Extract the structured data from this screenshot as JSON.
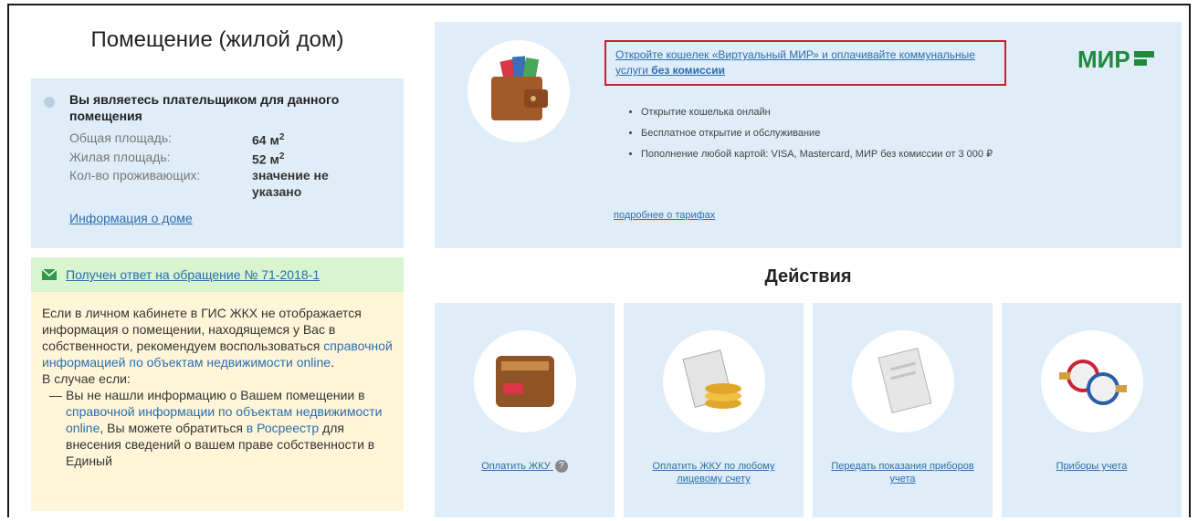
{
  "left": {
    "title": "Помещение (жилой дом)",
    "payer_text": "Вы являетесь плательщиком для данного помещения",
    "fields": [
      {
        "label": "Общая площадь:",
        "value": "64 м",
        "sup": "2"
      },
      {
        "label": "Жилая площадь:",
        "value": "52 м",
        "sup": "2"
      },
      {
        "label": "Кол-во проживающих:",
        "value": "значение не указано",
        "sup": ""
      }
    ],
    "house_link": "Информация о доме",
    "notice_link": "Получен ответ на обращение № 71-2018-1",
    "help": {
      "p1_a": "Если в личном кабинете в ГИС ЖКХ не отображается информация о помещении, находящемся у Вас в собственности, рекомендуем воспользоваться ",
      "p1_link": "справочной информацией по объектам недвижимости online",
      "p1_b": ".",
      "case_intro": "В случае если:",
      "case_dash": "—",
      "case_a": "Вы не нашли информацию о Вашем помещении в ",
      "case_link": "справочной информации по объектам недвижимости online",
      "case_b": ", Вы можете обратиться ",
      "case_link2": "в Росреестр",
      "case_c": " для внесения сведений о вашем праве собственности в Единый"
    }
  },
  "promo": {
    "headline_a": "Откройте кошелек «Виртуальный МИР» и оплачивайте коммунальные услуги ",
    "headline_bold": "без комиссии",
    "logo_text": "МИР",
    "bullets": [
      "Открытие кошелька онлайн",
      "Бесплатное открытие и обслуживание",
      "Пополнение любой картой: VISA, Mastercard, МИР без комиссии от 3 000 ₽"
    ],
    "tariff_link": "подробнее о тарифах"
  },
  "actions": {
    "title": "Действия",
    "cards": [
      {
        "label": "Оплатить ЖКУ",
        "icon": "wallet-icon",
        "badge": "?"
      },
      {
        "label": "Оплатить ЖКУ по любому лицевому счету",
        "icon": "receipt-coins-icon"
      },
      {
        "label": "Передать показания приборов учета",
        "icon": "document-icon"
      },
      {
        "label": "Приборы учета",
        "icon": "water-meter-icon"
      }
    ]
  },
  "colors": {
    "panel_blue": "#dfedf8",
    "notice_green": "#d8f5d0",
    "help_yellow": "#fff6d9",
    "link_blue": "#2a6db0",
    "highlight_red": "#c8202f",
    "mir_green": "#1f8a3c"
  }
}
